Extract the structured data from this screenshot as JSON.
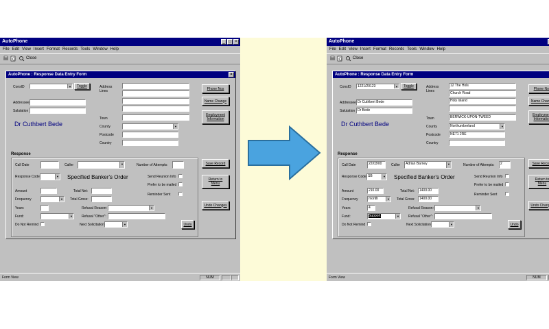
{
  "app": {
    "title": "AutoPhone",
    "menu": [
      "File",
      "Edit",
      "View",
      "Insert",
      "Format",
      "Records",
      "Tools",
      "Window",
      "Help"
    ],
    "toolbar_close": "Close",
    "status_left": "Form View",
    "status_num": "NUM"
  },
  "form": {
    "title": "AutoPhone : Response Data Entry Form",
    "labels": {
      "consid": "ConsID",
      "toggle": "Toggle",
      "address_lines": "Address\nLines",
      "addressee": "Addressee",
      "salutation": "Salutation",
      "town": "Town",
      "county": "County",
      "postcode": "Postcode",
      "country": "Country",
      "response": "Response",
      "call_date": "Call Date",
      "caller": "Caller",
      "attempts": "Number of Attempts:",
      "response_code": "Response Code",
      "send_reunion": "Send Reunion Info",
      "prefer_mailed": "Prefer to be mailed",
      "reminder_sent": "Reminder Sent",
      "amount": "Amount",
      "total_net": "Total Net:",
      "frequency": "Frequency",
      "total_gross": "Total Gross:",
      "years": "Years",
      "refusal_reason": "Refusal Reason:",
      "fund": "Fund:",
      "refusal_other": "Refusal \"Other\":",
      "do_not_remind": "Do Not Remind",
      "next_solicitation": "Next Solicitation:"
    },
    "buttons": {
      "phone_nos": "Phone Nos",
      "name_change": "Name Change",
      "employment": "Employment\nInformation",
      "save_record": "Save Record",
      "return_menu": "Return to\nMenu",
      "undo_changes": "Undo Changes",
      "undo": "Undo"
    },
    "order_text": "Specified Banker's Order",
    "donor_name": "Dr Cuthbert Bede"
  },
  "before": {
    "consid": "",
    "addressee": "",
    "salutation": "",
    "address": [
      "",
      "",
      "",
      ""
    ],
    "town": "",
    "county": "",
    "postcode": "",
    "country": "",
    "call_date": "",
    "caller": "",
    "attempts": "",
    "response_code": "",
    "amount": "",
    "total_net": "",
    "frequency": "",
    "total_gross": "",
    "years": "",
    "fund": ""
  },
  "after": {
    "consid": "1221/20123",
    "addressee": "Dr Cuthbert Bede",
    "salutation": "Dr Bede",
    "address": [
      "12 The Hols",
      "Church Road",
      "Holy Island",
      ""
    ],
    "town": "BERWICK-UPON-TWEED",
    "county": "Northumberland",
    "postcode": "NE71 2RE",
    "country": "",
    "call_date": "22/03/00",
    "caller": "Adrian Barney",
    "attempts": "2",
    "response_code": "SB",
    "amount": "210.00",
    "total_net": "1400.00",
    "frequency": "month",
    "total_gross": "1400.00",
    "years": "4",
    "fund": "Support"
  },
  "colors": {
    "titlebar": "#000080",
    "window": "#c0c0c0",
    "arrow": "#4aa3df"
  }
}
